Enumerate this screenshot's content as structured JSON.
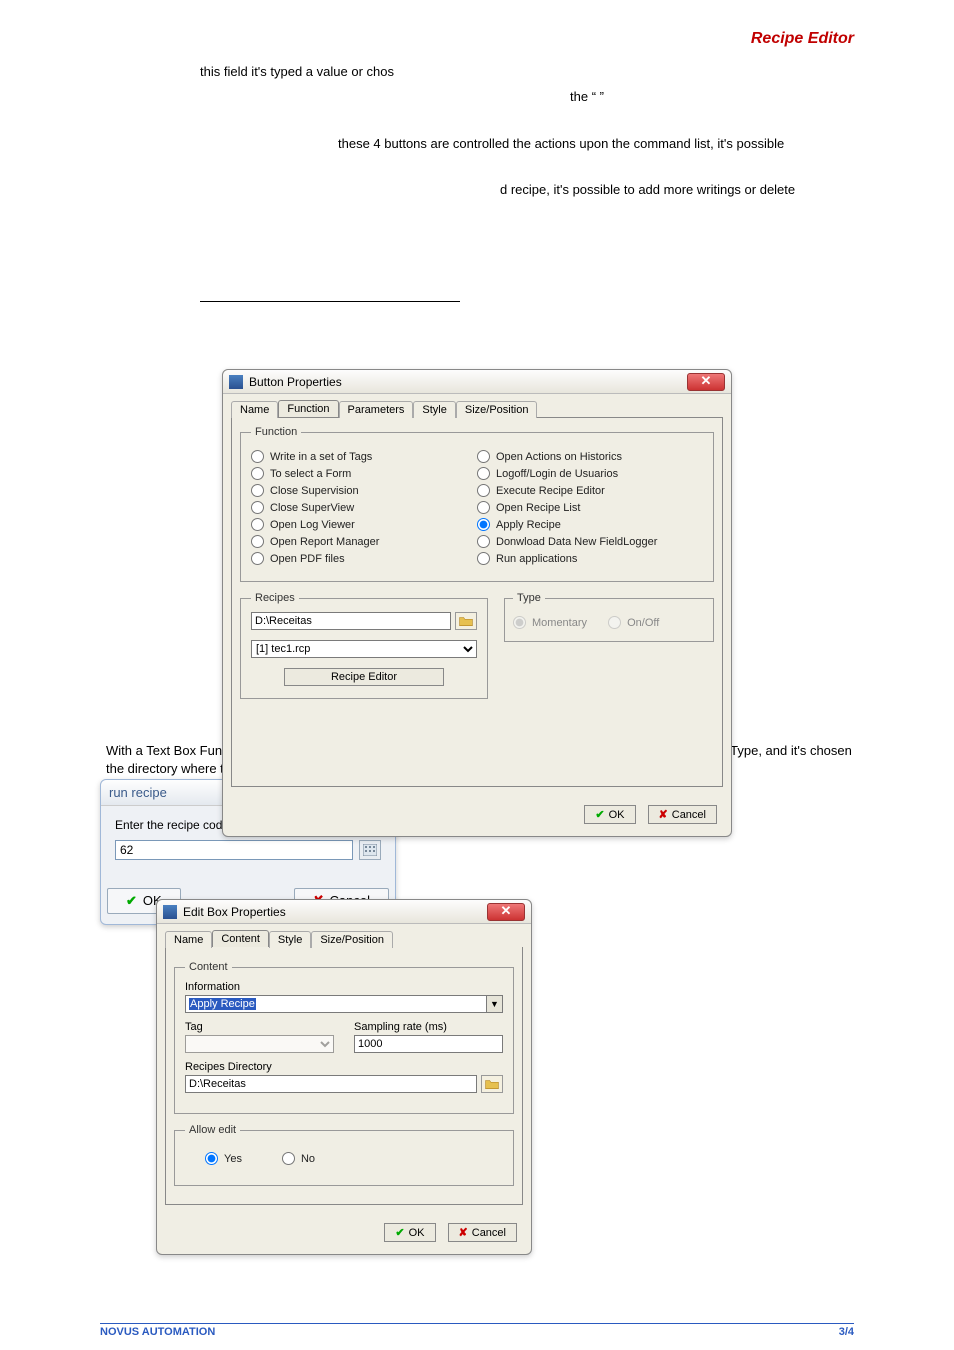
{
  "header": {
    "title": "Recipe Editor"
  },
  "body": {
    "line1": "this field it's typed a value or chos",
    "line2": "the “               ”",
    "line3": "these 4 buttons are controlled the actions upon the command list, it's possible",
    "line4": "d recipe, it's possible to add more writings or delete",
    "para2": "With a Text Box Function, in the text box properties, it's selected the “Execute Recipes” option in Information Type, and it's chosen the directory where the recipe files are saved  In supervision mode, by clicking the textbox it's shown"
  },
  "dlg1": {
    "title": "Button Properties",
    "tabs": [
      "Name",
      "Function",
      "Parameters",
      "Style",
      "Size/Position"
    ],
    "activeTab": 1,
    "function_legend": "Function",
    "options_left": [
      "Write in a set of Tags",
      "To select a Form",
      "Close Supervision",
      "Close SuperView",
      "Open Log Viewer",
      "Open Report Manager",
      "Open PDF files"
    ],
    "options_right": [
      "Open Actions on Historics",
      "Logoff/Login de Usuarios",
      "Execute Recipe Editor",
      "Open Recipe List",
      "Apply Recipe",
      "Donwload Data New FieldLogger",
      "Run applications"
    ],
    "selected": "Apply Recipe",
    "recipes_legend": "Recipes",
    "recipes_path": "D:\\Receitas",
    "recipes_file": "[1] tec1.rcp",
    "recipe_editor_btn": "Recipe Editor",
    "type_legend": "Type",
    "type_opts": [
      "Momentary",
      "On/Off"
    ],
    "ok": "OK",
    "cancel": "Cancel"
  },
  "dlg2": {
    "title": "Edit Box Properties",
    "tabs": [
      "Name",
      "Content",
      "Style",
      "Size/Position"
    ],
    "activeTab": 1,
    "content_legend": "Content",
    "info_label": "Information",
    "info_value": "Apply Recipe",
    "tag_label": "Tag",
    "tag_value": "",
    "sampling_label": "Sampling rate (ms)",
    "sampling_value": "1000",
    "dir_label": "Recipes Directory",
    "dir_value": "D:\\Receitas",
    "allow_legend": "Allow edit",
    "allow_opts": [
      "Yes",
      "No"
    ],
    "allow_selected": "Yes",
    "ok": "OK",
    "cancel": "Cancel"
  },
  "dlg3": {
    "title": "run recipe",
    "prompt": "Enter the recipe code.",
    "value": "62",
    "ok": "OK",
    "cancel": "Cancel"
  },
  "footer": {
    "left": "NOVUS AUTOMATION",
    "right": "3/4"
  }
}
